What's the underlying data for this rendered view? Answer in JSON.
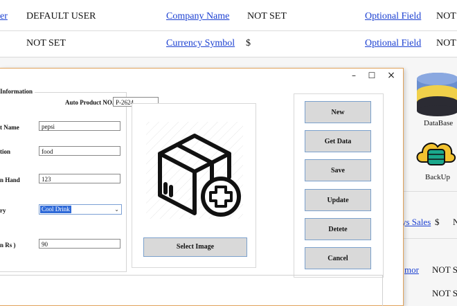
{
  "background": {
    "row1": {
      "user_label_fragment": "er",
      "user_value": "DEFAULT USER",
      "company_label": "Company Name",
      "company_value": "NOT SET",
      "optional_label": "Optional Field",
      "optional_value": "NOT"
    },
    "row2": {
      "field_value": "NOT SET",
      "currency_label": "Currency Symbol",
      "currency_value": "$",
      "optional_label": "Optional Field",
      "optional_value": "NOT"
    },
    "right": {
      "database_label": "DataBase",
      "backup_label": "BackUp",
      "sales_label": "ys Sales",
      "sales_currency": "$",
      "sales_value": "N",
      "mor_label": "mor",
      "mor_value": "NOT S",
      "bottom_value": "NOT S"
    }
  },
  "dialog": {
    "titlebar": {
      "minimize": "–",
      "maximize": "☐",
      "close": "×"
    },
    "group_title": "Information",
    "auto_product_label": "Auto Product NO.",
    "auto_product_value": "P-2624",
    "fields": {
      "name_label": "t Name",
      "name_value": "pepsi",
      "description_label": "tion",
      "description_value": "food",
      "on_hand_label": "n Hand",
      "on_hand_value": "123",
      "category_label": "ry",
      "category_value": "Cool Drink",
      "price_label": "n Rs )",
      "price_value": "90"
    },
    "select_image_label": "Select Image",
    "buttons": {
      "new": "New",
      "get_data": "Get Data",
      "save": "Save",
      "update": "Update",
      "delete": "Detete",
      "cancel": "Cancel"
    }
  },
  "colors": {
    "link": "#1a3fd1",
    "selection": "#2f6ad8",
    "button_bg": "#d9d9d9",
    "button_border": "#7aa0cc",
    "dialog_border": "#e0a25a",
    "db_top": "#6a8fd0",
    "db_middle": "#f0d04a",
    "db_bottom": "#2b2b33",
    "backup_cloud": "#f2c230",
    "backup_disk": "#1aa88c"
  },
  "icons": {
    "product": "package-add-icon",
    "database": "database-icon",
    "backup": "cloud-backup-icon"
  }
}
